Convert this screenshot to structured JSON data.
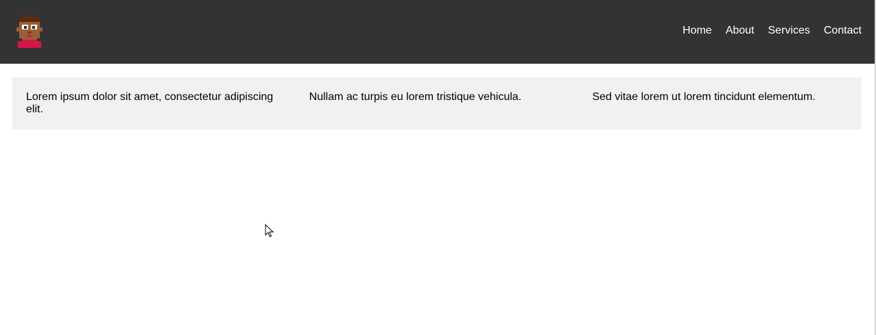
{
  "header": {
    "logo": {
      "icon": "pixel-avatar-icon",
      "colors": {
        "hair": "#5a2a12",
        "skin": "#9b5f34",
        "shirt": "#d4164a"
      }
    },
    "nav": [
      {
        "label": "Home"
      },
      {
        "label": "About"
      },
      {
        "label": "Services"
      },
      {
        "label": "Contact"
      }
    ],
    "background": "#333333"
  },
  "main": {
    "columns": [
      {
        "text": "Lorem ipsum dolor sit amet, consectetur adipiscing elit."
      },
      {
        "text": "Nullam ac turpis eu lorem tristique vehicula."
      },
      {
        "text": "Sed vitae lorem ut lorem tincidunt elementum."
      }
    ],
    "background": "#f1f1f1"
  }
}
